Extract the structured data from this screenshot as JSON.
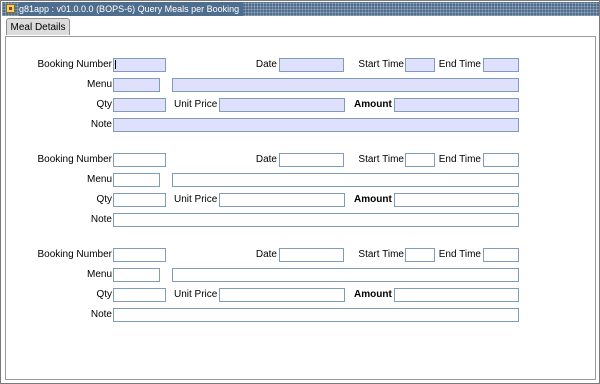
{
  "window": {
    "title": "g81app : v01.0.0.0 (BOPS-6) Query Meals per Booking",
    "icon": "app-icon"
  },
  "tabs": [
    {
      "label": "Meal Details",
      "selected": true
    }
  ],
  "labels": {
    "booking_number": "Booking Number",
    "date": "Date",
    "start_time": "Start Time",
    "end_time": "End Time",
    "menu": "Menu",
    "qty": "Qty",
    "unit_price": "Unit Price",
    "amount": "Amount",
    "note": "Note"
  },
  "records": [
    {
      "booking_number": "",
      "date": "",
      "start_time": "",
      "end_time": "",
      "menu_code": "",
      "menu_description": "",
      "qty": "",
      "unit_price": "",
      "amount": "",
      "note": "",
      "active": true
    },
    {
      "booking_number": "",
      "date": "",
      "start_time": "",
      "end_time": "",
      "menu_code": "",
      "menu_description": "",
      "qty": "",
      "unit_price": "",
      "amount": "",
      "note": "",
      "active": false
    },
    {
      "booking_number": "",
      "date": "",
      "start_time": "",
      "end_time": "",
      "menu_code": "",
      "menu_description": "",
      "qty": "",
      "unit_price": "",
      "amount": "",
      "note": "",
      "active": false
    }
  ],
  "colors": {
    "titlebar": "#4f6d8c",
    "active_field": "#dfe0fb",
    "field_border": "#7f9db9"
  }
}
